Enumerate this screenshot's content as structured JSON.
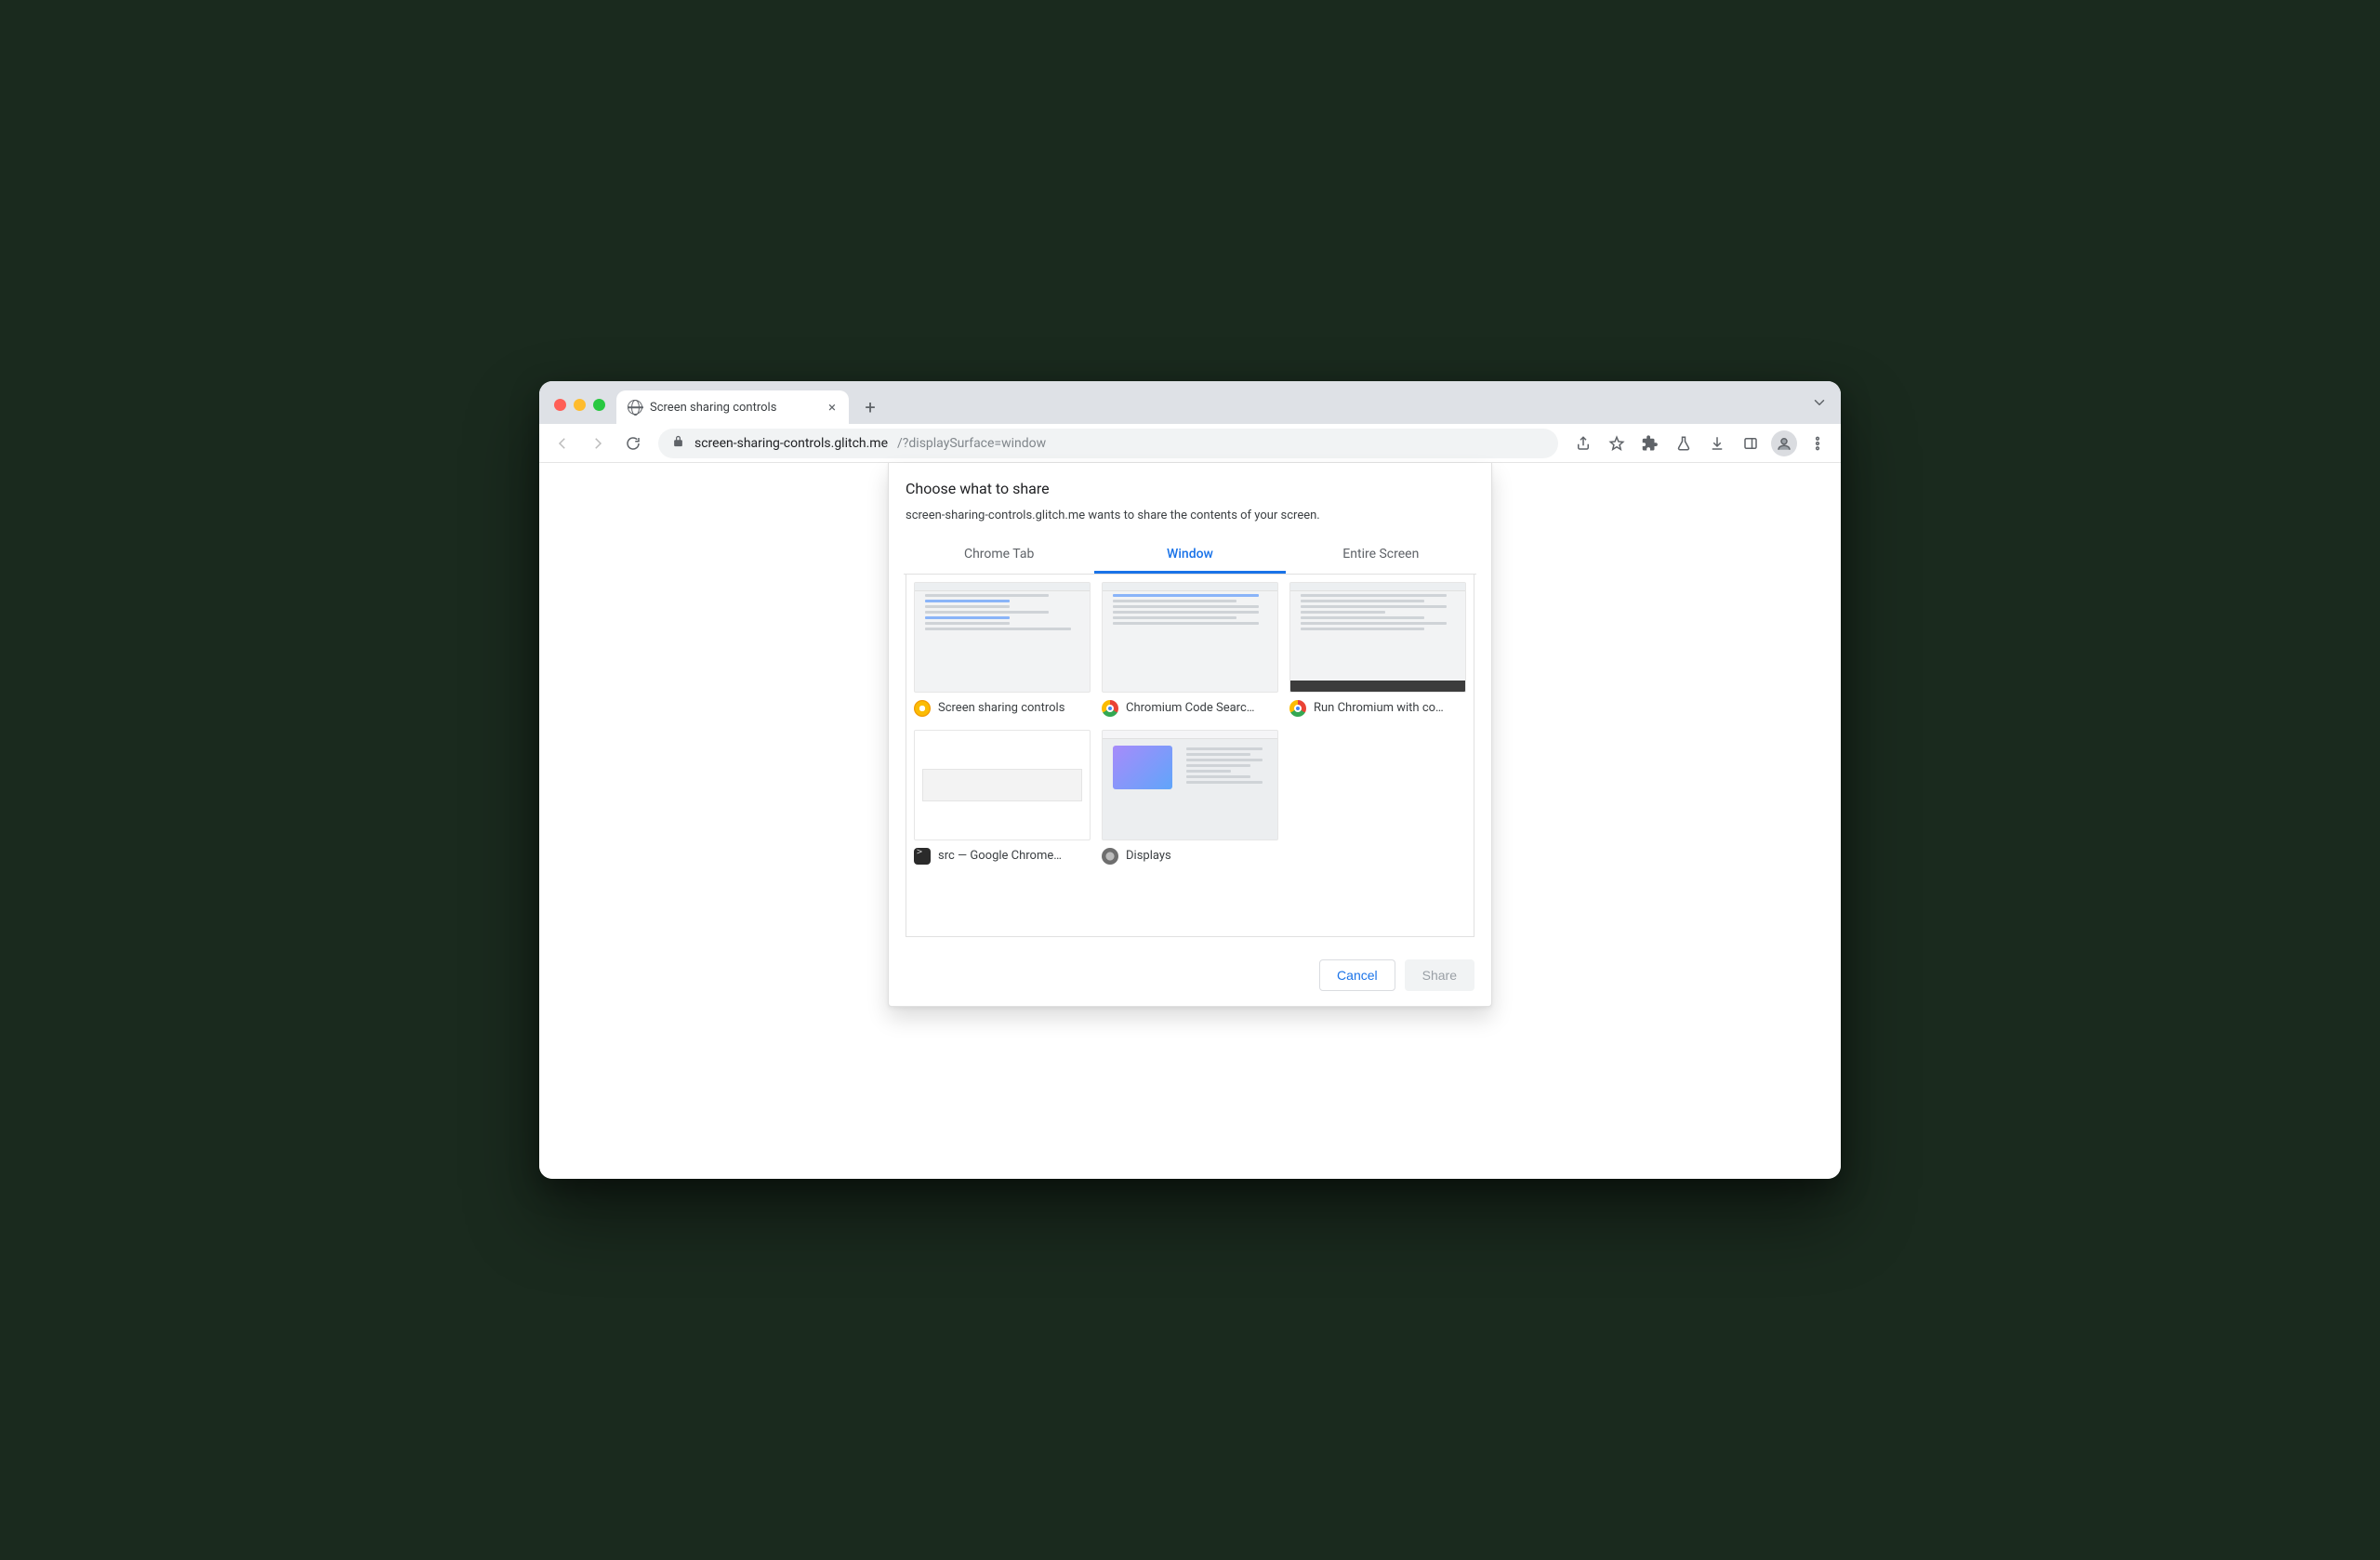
{
  "tab": {
    "title": "Screen sharing controls"
  },
  "omnibox": {
    "host": "screen-sharing-controls.glitch.me",
    "path": "/?displaySurface=window"
  },
  "picker": {
    "title": "Choose what to share",
    "subtitle": "screen-sharing-controls.glitch.me wants to share the contents of your screen.",
    "tabs": {
      "chrome_tab": "Chrome Tab",
      "window": "Window",
      "entire_screen": "Entire Screen"
    },
    "active_tab": "window",
    "sources": [
      {
        "label": "Screen sharing controls",
        "icon": "canary"
      },
      {
        "label": "Chromium Code Searc…",
        "icon": "chrome"
      },
      {
        "label": "Run Chromium with co…",
        "icon": "chrome"
      },
      {
        "label": "src — Google Chrome…",
        "icon": "term"
      },
      {
        "label": "Displays",
        "icon": "sys"
      }
    ],
    "buttons": {
      "cancel": "Cancel",
      "share": "Share"
    }
  }
}
